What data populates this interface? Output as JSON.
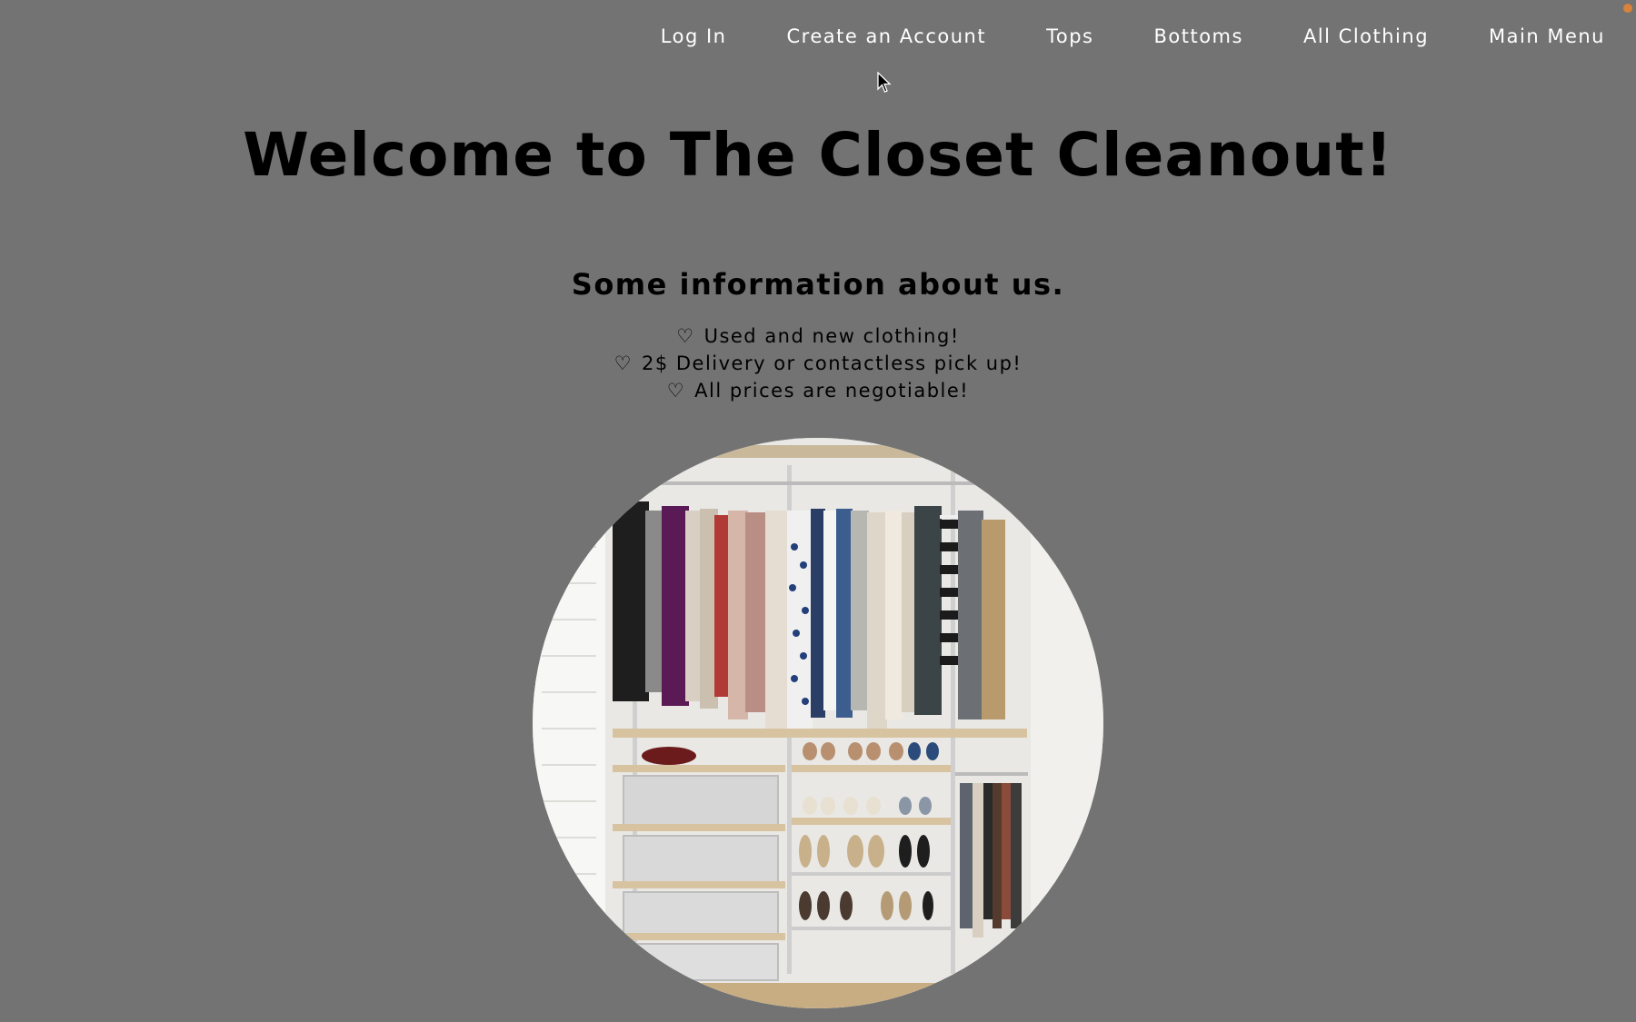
{
  "nav": {
    "items": [
      {
        "label": "Log In"
      },
      {
        "label": "Create an Account"
      },
      {
        "label": "Tops"
      },
      {
        "label": "Bottoms"
      },
      {
        "label": "All Clothing"
      },
      {
        "label": "Main Menu"
      }
    ]
  },
  "hero": {
    "title": "Welcome to The Closet Cleanout!",
    "subtitle": "Some information about us.",
    "info": [
      {
        "icon": "heart-icon",
        "glyph": "♡",
        "text": "Used and new clothing!"
      },
      {
        "icon": "heart-icon",
        "glyph": "♡",
        "text": "2$ Delivery or contactless pick up!"
      },
      {
        "icon": "heart-icon",
        "glyph": "♡",
        "text": "All prices are negotiable!"
      }
    ]
  },
  "image": {
    "content": "closet-photo"
  },
  "colors": {
    "background": "#737373",
    "nav_text": "#ffffff",
    "heading_text": "#000000",
    "status_dot": "#d9823a"
  }
}
